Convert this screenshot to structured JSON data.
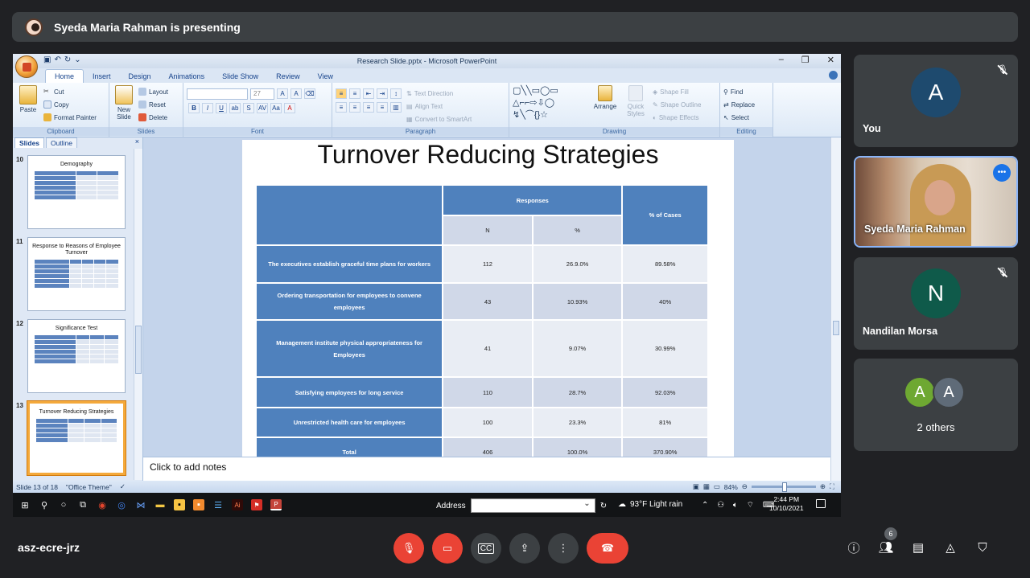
{
  "meeting": {
    "presenter_banner": "Syeda Maria Rahman is presenting",
    "code": "asz-ecre-jrz",
    "participants_count": "6"
  },
  "powerpoint": {
    "window_title": "Research Slide.pptx - Microsoft PowerPoint",
    "tabs": [
      "Home",
      "Insert",
      "Design",
      "Animations",
      "Slide Show",
      "Review",
      "View"
    ],
    "clipboard": {
      "paste": "Paste",
      "cut": "Cut",
      "copy": "Copy",
      "format_painter": "Format Painter",
      "label": "Clipboard"
    },
    "slides_group": {
      "new_slide": "New Slide",
      "layout": "Layout",
      "reset": "Reset",
      "delete": "Delete",
      "label": "Slides"
    },
    "font_group": {
      "size": "27",
      "label": "Font"
    },
    "paragraph_group": {
      "text_direction": "Text Direction",
      "align_text": "Align Text",
      "convert_smartart": "Convert to SmartArt",
      "label": "Paragraph"
    },
    "drawing_group": {
      "arrange": "Arrange",
      "quick_styles": "Quick Styles",
      "shape_fill": "Shape Fill",
      "shape_outline": "Shape Outline",
      "shape_effects": "Shape Effects",
      "label": "Drawing"
    },
    "editing_group": {
      "find": "Find",
      "replace": "Replace",
      "select": "Select",
      "label": "Editing"
    },
    "panel_tabs": {
      "slides": "Slides",
      "outline": "Outline"
    },
    "thumbnails": [
      {
        "num": "10",
        "title": "Demography"
      },
      {
        "num": "11",
        "title": "Response to Reasons of Employee Turnover"
      },
      {
        "num": "12",
        "title": "Significance Test"
      },
      {
        "num": "13",
        "title": "Turnover Reducing Strategies"
      }
    ],
    "slide": {
      "title": "Turnover Reducing Strategies",
      "header_responses": "Responses",
      "header_cases": "% of Cases",
      "sub_n": "N",
      "sub_pct": "%",
      "rows": [
        {
          "label": "The executives establish graceful time plans for workers",
          "n": "112",
          "pct": "26.9.0%",
          "cases": "89.58%"
        },
        {
          "label": "Ordering transportation for employees to convene employees",
          "n": "43",
          "pct": "10.93%",
          "cases": "40%"
        },
        {
          "label": "Management institute physical appropriateness for Employees",
          "n": "41",
          "pct": "9.07%",
          "cases": "30.99%"
        },
        {
          "label": "Satisfying employees for long service",
          "n": "110",
          "pct": "28.7%",
          "cases": "92.03%"
        },
        {
          "label": "Unrestricted health care for employees",
          "n": "100",
          "pct": "23.3%",
          "cases": "81%"
        },
        {
          "label": "Total",
          "n": "406",
          "pct": "100.0%",
          "cases": "370.90%"
        }
      ]
    },
    "notes_placeholder": "Click to add notes",
    "status": {
      "slide_info": "Slide 13 of 18",
      "theme": "\"Office Theme\"",
      "zoom": "84%"
    }
  },
  "taskbar": {
    "address_label": "Address",
    "weather": "93°F  Light rain",
    "time": "2:44 PM",
    "date": "10/10/2021"
  },
  "tiles": [
    {
      "name": "You",
      "initial": "A",
      "color": "#1e4a6e"
    },
    {
      "name": "Syeda Maria Rahman"
    },
    {
      "name": "Nandilan Morsa",
      "initial": "N",
      "color": "#0f5a4a"
    },
    {
      "name": "2 others",
      "initials": [
        "A",
        "A"
      ],
      "colors": [
        "#6ea832",
        "#5f6b78"
      ]
    }
  ]
}
